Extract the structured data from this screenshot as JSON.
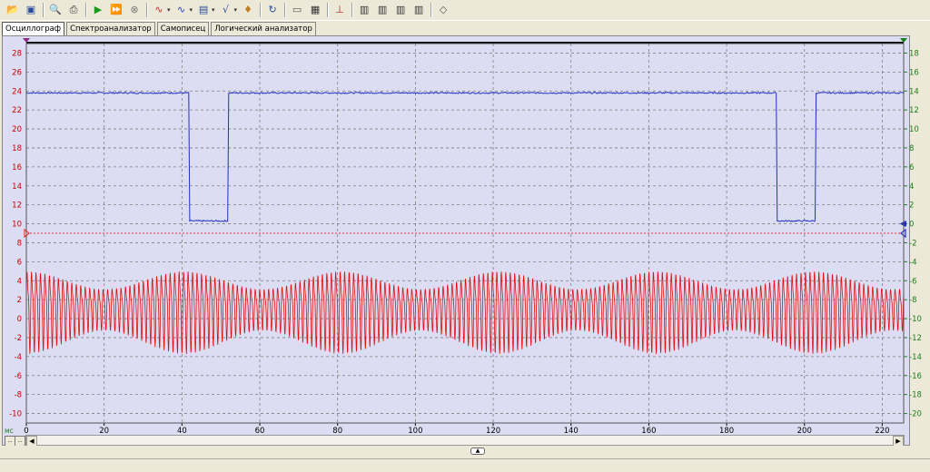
{
  "toolbar": {
    "icons": [
      "open-folder-icon",
      "save-icon",
      "print-preview-icon",
      "print-icon",
      "play-icon",
      "play-continuous-icon",
      "stop-icon",
      "signal-red-icon",
      "signal-blue-icon",
      "calculator-icon",
      "math-function-icon",
      "probe-icon",
      "refresh-icon",
      "window-icon",
      "data-table-icon",
      "cursor-measure-icon",
      "channel-a-icon",
      "channel-b-icon",
      "channel-c-icon",
      "channel-d-icon",
      "eraser-icon"
    ],
    "math_label": "√x"
  },
  "tabs": [
    "Осциллограф",
    "Спектроанализатор",
    "Самописец",
    "Логический анализатор"
  ],
  "active_tab": 0,
  "x_axis": {
    "unit": "мс",
    "ticks": [
      "0",
      "20",
      "40",
      "60",
      "80",
      "100",
      "120",
      "140",
      "160",
      "180",
      "200",
      "220"
    ],
    "range": [
      0,
      225.5
    ]
  },
  "y_left": {
    "ticks": [
      "28",
      "26",
      "24",
      "22",
      "20",
      "18",
      "16",
      "14",
      "12",
      "10",
      "8",
      "6",
      "4",
      "2",
      "0",
      "-2",
      "-4",
      "-6",
      "-8",
      "-10"
    ],
    "range": [
      -11,
      29
    ],
    "color": "#c80000"
  },
  "y_right": {
    "ticks": [
      "18",
      "16",
      "14",
      "12",
      "10",
      "8",
      "6",
      "4",
      "2",
      "0",
      "-2",
      "-4",
      "-6",
      "-8",
      "-10",
      "-12",
      "-14",
      "-16",
      "-18",
      "-20"
    ],
    "range": [
      -21,
      19
    ],
    "color": "#1a7f1a"
  },
  "colors": {
    "blue_trace": "#2030c0",
    "red_trace": "#e01010",
    "plot_bg": "#dcdcf2",
    "grid": "#808080",
    "trigger": "#ff3030"
  },
  "blue_channel": {
    "high": 23.8,
    "low": 10.3,
    "low_intervals_ms": [
      [
        42,
        52
      ],
      [
        193,
        203
      ]
    ]
  },
  "red_channel": {
    "period_ms": 1.15,
    "min": -4.0,
    "max": 6.5
  },
  "trigger_level": 9.0
}
